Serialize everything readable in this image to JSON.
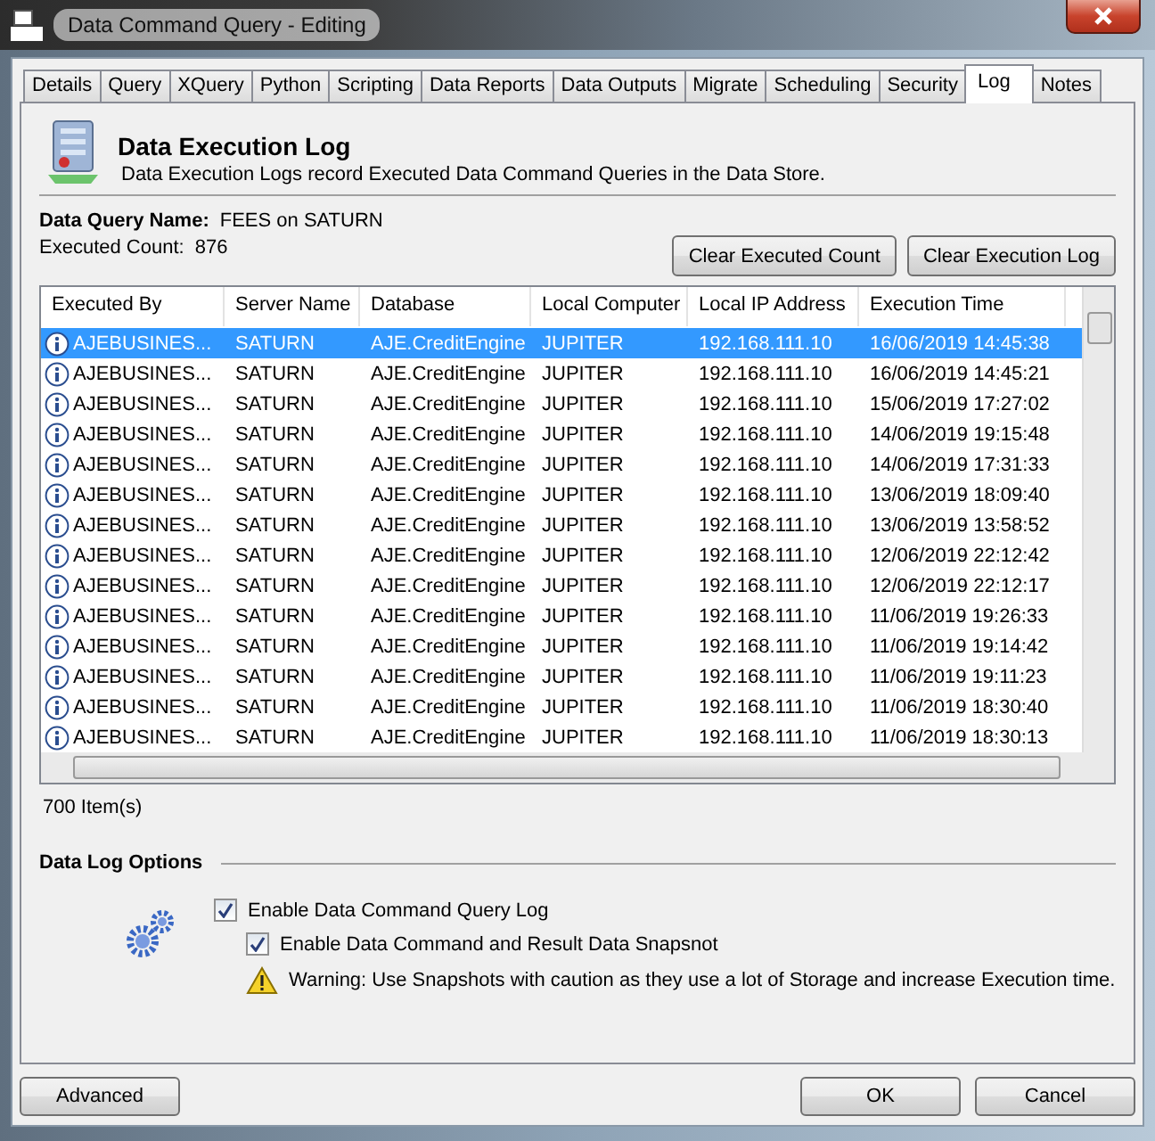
{
  "window": {
    "title": "Data Command Query - Editing"
  },
  "tabs": [
    {
      "label": "Details",
      "selected": false
    },
    {
      "label": "Query",
      "selected": false
    },
    {
      "label": "XQuery",
      "selected": false
    },
    {
      "label": "Python",
      "selected": false
    },
    {
      "label": "Scripting",
      "selected": false
    },
    {
      "label": "Data Reports",
      "selected": false
    },
    {
      "label": "Data Outputs",
      "selected": false
    },
    {
      "label": "Migrate",
      "selected": false
    },
    {
      "label": "Scheduling",
      "selected": false
    },
    {
      "label": "Security",
      "selected": false
    },
    {
      "label": "Log",
      "selected": true
    },
    {
      "label": "Notes",
      "selected": false
    }
  ],
  "header": {
    "title": "Data Execution Log",
    "description": "Data Execution Logs record Executed Data Command Queries in the Data Store."
  },
  "query_name": {
    "label": "Data Query Name:",
    "value": "FEES on SATURN"
  },
  "executed_count": {
    "label": "Executed Count:",
    "value": "876"
  },
  "actions": [
    "Clear Executed Count",
    "Clear Execution Log"
  ],
  "table": {
    "columns": [
      "Executed By",
      "Server Name",
      "Database",
      "Local Computer",
      "Local IP Address",
      "Execution Time"
    ],
    "rows": [
      {
        "cells": [
          "AJEBUSINES...",
          "SATURN",
          "AJE.CreditEngine",
          "JUPITER",
          "192.168.111.10",
          "16/06/2019 14:45:38"
        ],
        "selected": true
      },
      {
        "cells": [
          "AJEBUSINES...",
          "SATURN",
          "AJE.CreditEngine",
          "JUPITER",
          "192.168.111.10",
          "16/06/2019 14:45:21"
        ],
        "selected": false
      },
      {
        "cells": [
          "AJEBUSINES...",
          "SATURN",
          "AJE.CreditEngine",
          "JUPITER",
          "192.168.111.10",
          "15/06/2019 17:27:02"
        ],
        "selected": false
      },
      {
        "cells": [
          "AJEBUSINES...",
          "SATURN",
          "AJE.CreditEngine",
          "JUPITER",
          "192.168.111.10",
          "14/06/2019 19:15:48"
        ],
        "selected": false
      },
      {
        "cells": [
          "AJEBUSINES...",
          "SATURN",
          "AJE.CreditEngine",
          "JUPITER",
          "192.168.111.10",
          "14/06/2019 17:31:33"
        ],
        "selected": false
      },
      {
        "cells": [
          "AJEBUSINES...",
          "SATURN",
          "AJE.CreditEngine",
          "JUPITER",
          "192.168.111.10",
          "13/06/2019 18:09:40"
        ],
        "selected": false
      },
      {
        "cells": [
          "AJEBUSINES...",
          "SATURN",
          "AJE.CreditEngine",
          "JUPITER",
          "192.168.111.10",
          "13/06/2019 13:58:52"
        ],
        "selected": false
      },
      {
        "cells": [
          "AJEBUSINES...",
          "SATURN",
          "AJE.CreditEngine",
          "JUPITER",
          "192.168.111.10",
          "12/06/2019 22:12:42"
        ],
        "selected": false
      },
      {
        "cells": [
          "AJEBUSINES...",
          "SATURN",
          "AJE.CreditEngine",
          "JUPITER",
          "192.168.111.10",
          "12/06/2019 22:12:17"
        ],
        "selected": false
      },
      {
        "cells": [
          "AJEBUSINES...",
          "SATURN",
          "AJE.CreditEngine",
          "JUPITER",
          "192.168.111.10",
          "11/06/2019 19:26:33"
        ],
        "selected": false
      },
      {
        "cells": [
          "AJEBUSINES...",
          "SATURN",
          "AJE.CreditEngine",
          "JUPITER",
          "192.168.111.10",
          "11/06/2019 19:14:42"
        ],
        "selected": false
      },
      {
        "cells": [
          "AJEBUSINES...",
          "SATURN",
          "AJE.CreditEngine",
          "JUPITER",
          "192.168.111.10",
          "11/06/2019 19:11:23"
        ],
        "selected": false
      },
      {
        "cells": [
          "AJEBUSINES...",
          "SATURN",
          "AJE.CreditEngine",
          "JUPITER",
          "192.168.111.10",
          "11/06/2019 18:30:40"
        ],
        "selected": false
      },
      {
        "cells": [
          "AJEBUSINES...",
          "SATURN",
          "AJE.CreditEngine",
          "JUPITER",
          "192.168.111.10",
          "11/06/2019 18:30:13"
        ],
        "selected": false
      }
    ]
  },
  "item_count": "700 Item(s)",
  "options": {
    "title": "Data Log Options",
    "items": [
      {
        "label": "Enable Data Command Query Log",
        "checked": true,
        "kind": "checkbox"
      },
      {
        "label": "Enable Data Command and Result Data Snapsnot",
        "checked": true,
        "kind": "checkbox"
      },
      {
        "label": "Warning: Use Snapshots with caution as they use a lot of Storage and increase Execution time.",
        "kind": "warning"
      }
    ]
  },
  "footer": {
    "left": [
      "Advanced"
    ],
    "right": [
      "OK",
      "Cancel"
    ]
  }
}
